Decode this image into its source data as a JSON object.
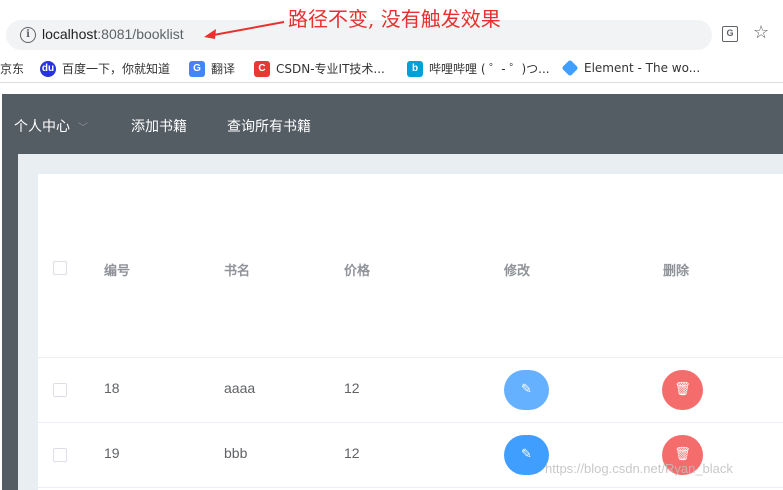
{
  "browser": {
    "url_host": "localhost",
    "url_rest": ":8081/booklist",
    "info_icon": "info-icon",
    "translate_icon": "translate-icon",
    "star_icon": "star-icon"
  },
  "annotation": {
    "text": "路径不变, 没有触发效果",
    "color": "#e8312f"
  },
  "bookmarks": [
    {
      "label": "京东"
    },
    {
      "label": "百度一下，你就知道",
      "icon": "baidu-icon"
    },
    {
      "label": "翻译",
      "icon": "google-translate-icon"
    },
    {
      "label": "CSDN-专业IT技术...",
      "icon": "csdn-icon"
    },
    {
      "label": "哔哩哔哩 ( ゜- ゜)つ...",
      "icon": "bilibili-icon"
    },
    {
      "label": "Element - The wo...",
      "icon": "element-icon"
    }
  ],
  "navbar": {
    "items": [
      {
        "label": "个人中心",
        "has_dropdown": true
      },
      {
        "label": "添加书籍"
      },
      {
        "label": "查询所有书籍"
      }
    ],
    "bg_color": "#545c64"
  },
  "table": {
    "headers": {
      "id": "编号",
      "name": "书名",
      "price": "价格",
      "edit": "修改",
      "delete": "删除"
    },
    "rows": [
      {
        "id": "18",
        "name": "aaaa",
        "price": "12"
      },
      {
        "id": "19",
        "name": "bbb",
        "price": "12"
      }
    ],
    "edit_icon": "edit-icon",
    "delete_icon": "delete-icon"
  },
  "watermark": "https://blog.csdn.net/Ryan_black"
}
